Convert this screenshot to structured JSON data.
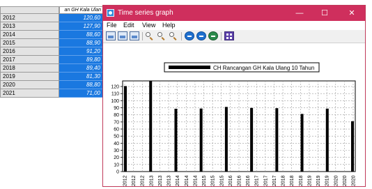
{
  "spreadsheet": {
    "column_header": "an GH Kala Ulan",
    "rows": [
      {
        "year": "2012",
        "value": "120,60"
      },
      {
        "year": "2013",
        "value": "127,90"
      },
      {
        "year": "2014",
        "value": "88,60"
      },
      {
        "year": "2015",
        "value": "88,90"
      },
      {
        "year": "2016",
        "value": "91,20"
      },
      {
        "year": "2017",
        "value": "89,80"
      },
      {
        "year": "2018",
        "value": "89,40"
      },
      {
        "year": "2019",
        "value": "81,30"
      },
      {
        "year": "2020",
        "value": "88,80"
      },
      {
        "year": "2021",
        "value": "71,00"
      }
    ],
    "selection_color": "#1a78e0"
  },
  "window": {
    "title": "Time series graph",
    "accent_color": "#cf2f5d",
    "controls": {
      "minimize": "—",
      "maximize": "☐",
      "close": "✕"
    },
    "menu": [
      "File",
      "Edit",
      "View",
      "Help"
    ],
    "toolbar_icons": [
      "image-icon",
      "image-icon",
      "image-icon",
      "zoom-icon",
      "zoom-in-icon",
      "zoom-out-icon",
      "previous-icon",
      "next-icon",
      "refresh-icon",
      "grid-icon"
    ]
  },
  "chart_data": {
    "type": "bar",
    "legend": "CH Rancangan GH Kala Ulang 10 Tahun",
    "legend_position": "top",
    "ylim": [
      0,
      127.9
    ],
    "yticks": [
      0,
      10,
      20,
      30,
      40,
      50,
      60,
      70,
      80,
      90,
      100,
      110,
      120
    ],
    "grid": true,
    "x_tick_labels": [
      "2012",
      "2012",
      "2012",
      "2013",
      "2013",
      "2013",
      "2014",
      "2014",
      "2014",
      "2015",
      "2015",
      "2015",
      "2016",
      "2016",
      "2016",
      "2017",
      "2017",
      "2017",
      "2018",
      "2018",
      "2018",
      "2019",
      "2019",
      "2019",
      "2020",
      "2020",
      "2020"
    ],
    "series": [
      {
        "color": "#000000",
        "x": [
          "2012",
          "2013",
          "2014",
          "2015",
          "2016",
          "2017",
          "2018",
          "2019",
          "2020",
          "2021"
        ],
        "values": [
          120.6,
          127.9,
          88.6,
          88.9,
          91.2,
          89.8,
          89.4,
          81.3,
          88.8,
          71.0
        ]
      }
    ]
  }
}
